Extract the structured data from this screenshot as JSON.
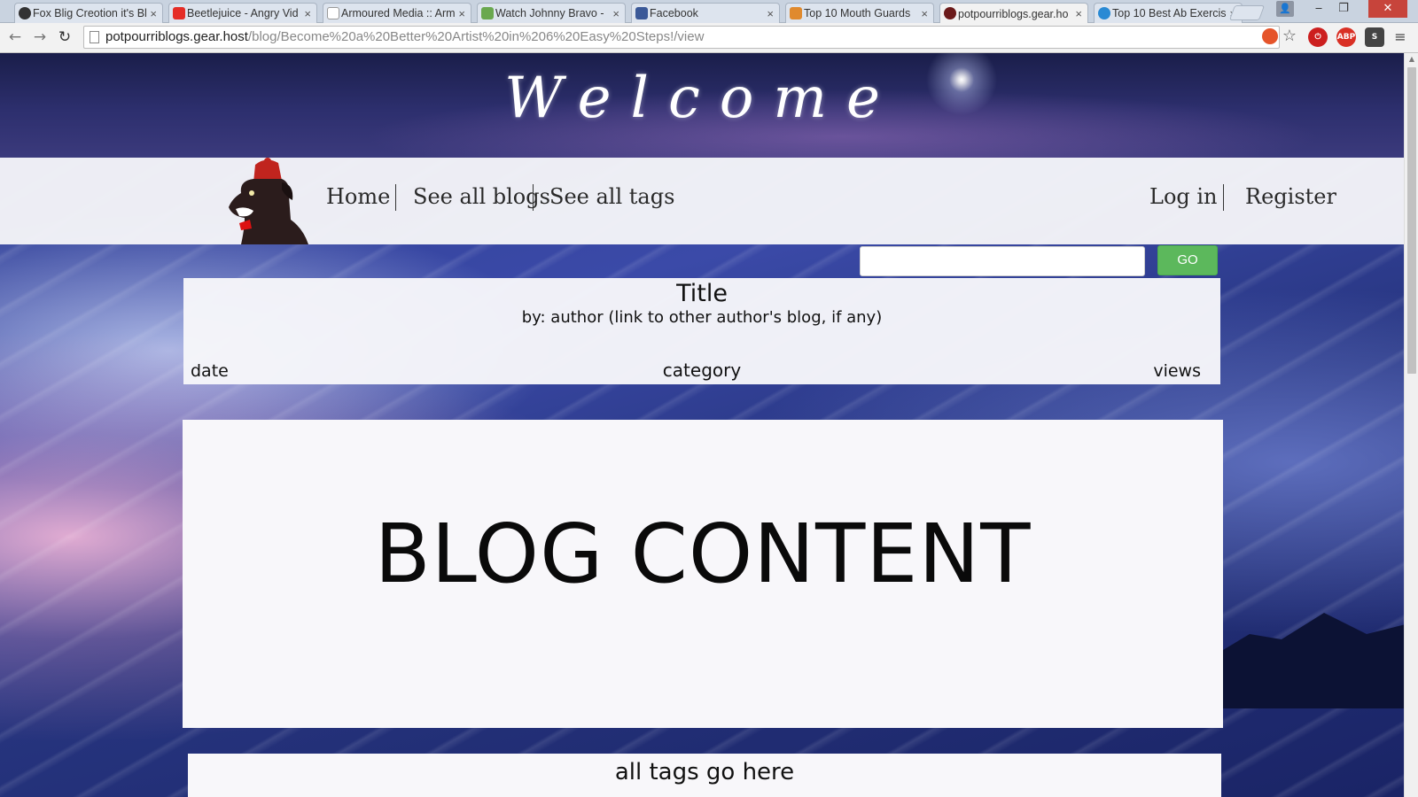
{
  "browser": {
    "tabs": [
      {
        "label": "Fox Blig Creotion it's Bl",
        "favicon_color": "#333333"
      },
      {
        "label": "Beetlejuice - Angry Vid",
        "favicon_color": "#e52d27"
      },
      {
        "label": "Armoured Media :: Arm",
        "favicon_color": "#9a9a9a"
      },
      {
        "label": "Watch Johnny Bravo - ",
        "favicon_color": "#6aa84f"
      },
      {
        "label": "Facebook",
        "favicon_color": "#3b5998"
      },
      {
        "label": "Top 10 Mouth Guards",
        "favicon_color": "#e08a2e"
      },
      {
        "label": "potpourriblogs.gear.ho",
        "favicon_color": "#6b1a1a"
      },
      {
        "label": "Top 10 Best Ab Exercis",
        "favicon_color": "#2a8ad4"
      }
    ],
    "close_glyph": "×",
    "window": {
      "minimize": "‒",
      "maximize": "❐",
      "close": "✕",
      "profile": "👤"
    },
    "nav": {
      "back": "←",
      "forward": "→",
      "reload": "↻"
    },
    "url": {
      "host": "potpourriblogs.gear.host",
      "path": "/blog/Become%20a%20Better%20Artist%20in%206%20Easy%20Steps!/view"
    },
    "extensions": [
      {
        "name": "lastpass-icon",
        "color": "#e5542a",
        "text": ""
      },
      {
        "name": "star-icon",
        "text": "☆"
      },
      {
        "name": "power-icon",
        "color": "#cc1f1f",
        "text": "⏻"
      },
      {
        "name": "adblock-icon",
        "color": "#d93025",
        "text": "ABP"
      },
      {
        "name": "s-extension-icon",
        "color": "#444444",
        "text": "S"
      }
    ],
    "menu_glyph": "≡"
  },
  "site": {
    "banner_title": "Welcome",
    "nav": {
      "home": "Home",
      "see_all_blogs": "See all blogs",
      "see_all_tags": "See all tags",
      "log_in": "Log in",
      "register": "Register"
    },
    "search": {
      "placeholder": "",
      "button": "GO"
    },
    "post": {
      "title": "Title",
      "author": "by: author (link to other author's blog, if any)",
      "date": "date",
      "category": "category",
      "views": "views",
      "content": "BLOG CONTENT",
      "tags": "all tags go here"
    }
  },
  "colors": {
    "go_button": "#5cb85c",
    "card_bg": "#f8f7fa",
    "banner_text": "#ffffff"
  }
}
